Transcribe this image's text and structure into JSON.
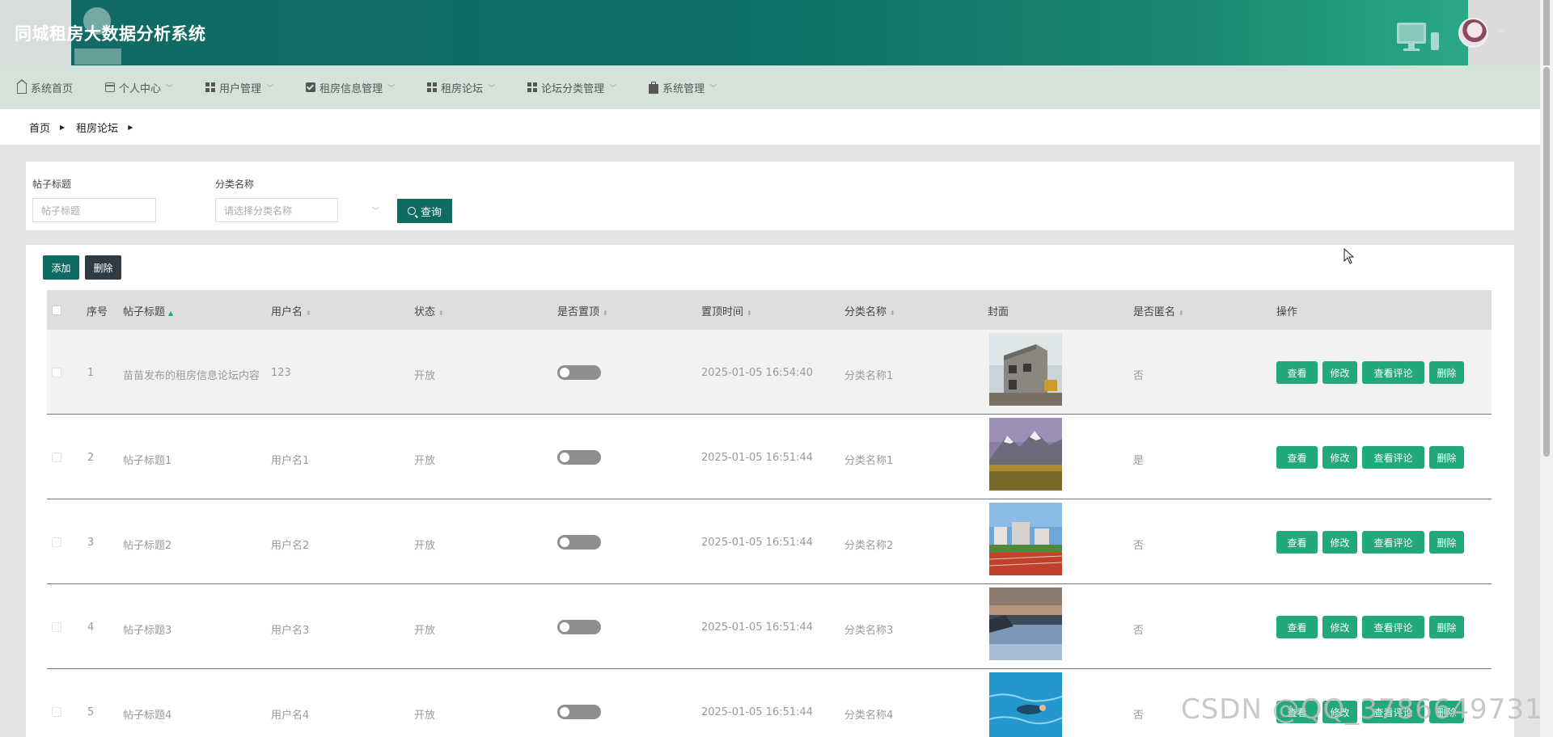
{
  "header": {
    "title": "同城租房大数据分析系统",
    "accent": "#0e6b62"
  },
  "nav": {
    "items": [
      {
        "label": "系统首页",
        "icon": "home-icon",
        "has_caret": false
      },
      {
        "label": "个人中心",
        "icon": "card-icon",
        "has_caret": true
      },
      {
        "label": "用户管理",
        "icon": "grid-icon",
        "has_caret": true
      },
      {
        "label": "租房信息管理",
        "icon": "check-square-icon",
        "has_caret": true
      },
      {
        "label": "租房论坛",
        "icon": "grid-icon",
        "has_caret": true
      },
      {
        "label": "论坛分类管理",
        "icon": "grid-icon",
        "has_caret": true
      },
      {
        "label": "系统管理",
        "icon": "briefcase-icon",
        "has_caret": true
      }
    ]
  },
  "breadcrumb": {
    "home": "首页",
    "current": "租房论坛"
  },
  "search": {
    "title_label": "帖子标题",
    "title_placeholder": "帖子标题",
    "category_label": "分类名称",
    "category_placeholder": "请选择分类名称",
    "query_button": "查询"
  },
  "toolbar": {
    "add_label": "添加",
    "delete_label": "删除"
  },
  "table": {
    "columns": [
      "序号",
      "帖子标题",
      "用户名",
      "状态",
      "是否置顶",
      "置顶时间",
      "分类名称",
      "封面",
      "是否匿名",
      "操作"
    ],
    "rows": [
      {
        "index": "1",
        "title": "苗苗发布的租房信息论坛内容",
        "username": "123",
        "status": "开放",
        "is_top": false,
        "top_time": "2025-01-05 16:54:40",
        "category": "分类名称1",
        "anonymous": "否"
      },
      {
        "index": "2",
        "title": "帖子标题1",
        "username": "用户名1",
        "status": "开放",
        "is_top": false,
        "top_time": "2025-01-05 16:51:44",
        "category": "分类名称1",
        "anonymous": "是"
      },
      {
        "index": "3",
        "title": "帖子标题2",
        "username": "用户名2",
        "status": "开放",
        "is_top": false,
        "top_time": "2025-01-05 16:51:44",
        "category": "分类名称2",
        "anonymous": "否"
      },
      {
        "index": "4",
        "title": "帖子标题3",
        "username": "用户名3",
        "status": "开放",
        "is_top": false,
        "top_time": "2025-01-05 16:51:44",
        "category": "分类名称3",
        "anonymous": "否"
      },
      {
        "index": "5",
        "title": "帖子标题4",
        "username": "用户名4",
        "status": "开放",
        "is_top": false,
        "top_time": "2025-01-05 16:51:44",
        "category": "分类名称4",
        "anonymous": "否"
      }
    ],
    "actions": {
      "view": "查看",
      "edit": "修改",
      "comments": "查看评论",
      "delete": "删除"
    },
    "action_color": "#22a87d"
  },
  "watermark": "CSDN @QQ_3786649731"
}
